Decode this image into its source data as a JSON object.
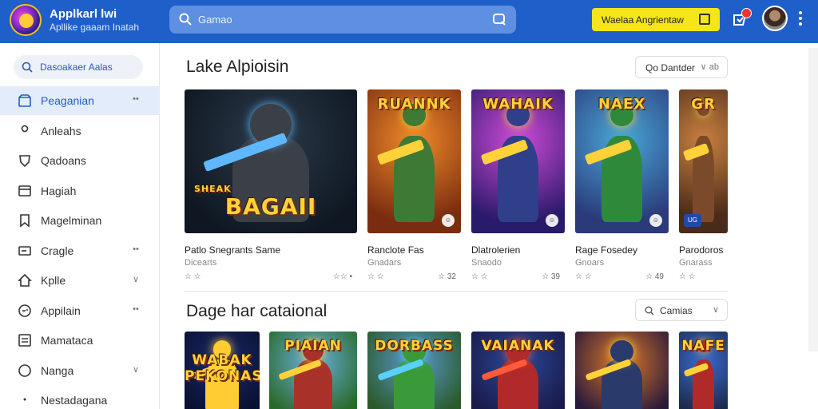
{
  "header": {
    "app_title": "Applkarl lwi",
    "app_subtitle": "Apllike gaaam Inatah",
    "search_text": "Gamao",
    "cta_label": "Waelaa Angrientaw"
  },
  "sidebar": {
    "search_text": "Dasoakaer Aalas",
    "items": [
      {
        "label": "Peaganian",
        "icon": "store-icon",
        "trail": "more"
      },
      {
        "label": "Anleahs",
        "icon": "person-icon",
        "trail": ""
      },
      {
        "label": "Qadoans",
        "icon": "shield-icon",
        "trail": ""
      },
      {
        "label": "Hagiah",
        "icon": "card-icon",
        "trail": ""
      },
      {
        "label": "Magelminan",
        "icon": "bookmark-icon",
        "trail": ""
      },
      {
        "label": "Cragle",
        "icon": "tag-icon",
        "trail": "more"
      },
      {
        "label": "Kplle",
        "icon": "home-icon",
        "trail": "chevron"
      },
      {
        "label": "Appilain",
        "icon": "gamepad-icon",
        "trail": "more"
      },
      {
        "label": "Mamataca",
        "icon": "list-icon",
        "trail": ""
      },
      {
        "label": "Nanga",
        "icon": "smile-icon",
        "trail": "chevron"
      },
      {
        "label": "Nestadagana",
        "icon": "rocket-icon",
        "trail": ""
      }
    ]
  },
  "sections": [
    {
      "title": "Lake Alpioisin",
      "filter_label": "Qo Dantder",
      "filter_trail": "∨ ab",
      "cards": [
        {
          "title": "Patlo Snegrants Same",
          "sub": "Dicearts",
          "meta": "☆ ☆",
          "meta_right": "☆☆ •",
          "art_text": "BAGAII",
          "art_sub": "SHEAK",
          "badge": "",
          "colors": {
            "bg1": "#2b3a4a",
            "bg2": "#0f1822",
            "fig": "#3b3f48",
            "accent": "#5fb8ff"
          }
        },
        {
          "title": "Ranclote Fas",
          "sub": "Gnadars",
          "meta": "☆ ☆",
          "meta_right": "☆ 32",
          "art_text": "RUANNK",
          "art_sub": "",
          "badge": "☺",
          "colors": {
            "bg1": "#f08a2a",
            "bg2": "#7a2c10",
            "fig": "#3d7a35",
            "accent": "#ffd23a"
          }
        },
        {
          "title": "Dlatrolerien",
          "sub": "Snaodo",
          "meta": "☆ ☆",
          "meta_right": "☆ 39",
          "art_text": "WAHAIK",
          "art_sub": "",
          "badge": "☺",
          "colors": {
            "bg1": "#d04ad8",
            "bg2": "#2a1a6a",
            "fig": "#2f3f8a",
            "accent": "#ffd23a"
          }
        },
        {
          "title": "Rage Fosedey",
          "sub": "Gnoars",
          "meta": "☆ ☆",
          "meta_right": "☆ 49",
          "art_text": "NAEX",
          "art_sub": "",
          "badge": "☺",
          "colors": {
            "bg1": "#4aa8d8",
            "bg2": "#2a3a7a",
            "fig": "#2e8a3a",
            "accent": "#ffd23a"
          }
        },
        {
          "title": "Parodoros",
          "sub": "Gnarass",
          "meta": "☆ ☆",
          "meta_right": "",
          "art_text": "GR",
          "art_sub": "",
          "badge": "UG",
          "colors": {
            "bg1": "#c88040",
            "bg2": "#4a2a18",
            "fig": "#7a4a2a",
            "accent": "#ffd23a"
          }
        }
      ]
    },
    {
      "title": "Dage har cataional",
      "filter_label": "Camias",
      "filter_trail": "∨",
      "cards": [
        {
          "art_text": "WABAK PEKONAS",
          "colors": {
            "bg1": "#1a2a6a",
            "bg2": "#0a1030",
            "fig": "#ffcc33",
            "accent": "#ffd23a"
          }
        },
        {
          "art_text": "PIAIAN",
          "colors": {
            "bg1": "#6ab0e0",
            "bg2": "#2a6a2a",
            "fig": "#a8322a",
            "accent": "#ffd23a"
          }
        },
        {
          "art_text": "DORBASS",
          "colors": {
            "bg1": "#5a9ad0",
            "bg2": "#2a5a2a",
            "fig": "#3a9a3a",
            "accent": "#5ad0ff"
          }
        },
        {
          "art_text": "VAIANAK",
          "colors": {
            "bg1": "#2a4a9a",
            "bg2": "#1a1a4a",
            "fig": "#b02a2a",
            "accent": "#ff5a3a"
          }
        },
        {
          "art_text": "",
          "colors": {
            "bg1": "#e07a2a",
            "bg2": "#2a1a3a",
            "fig": "#2a3a6a",
            "accent": "#ffd23a"
          }
        },
        {
          "art_text": "NAFE",
          "colors": {
            "bg1": "#3a6ad0",
            "bg2": "#1a2a4a",
            "fig": "#b02a2a",
            "accent": "#ffd23a"
          }
        }
      ]
    }
  ]
}
